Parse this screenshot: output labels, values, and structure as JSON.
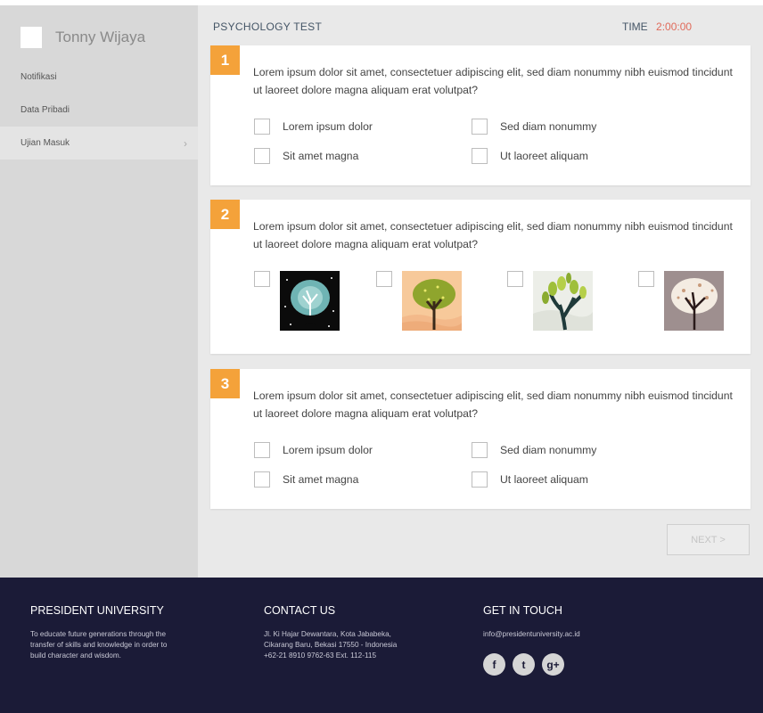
{
  "sidebar": {
    "user_name": "Tonny Wijaya",
    "items": [
      {
        "label": "Notifikasi"
      },
      {
        "label": "Data Pribadi"
      },
      {
        "label": "Ujian Masuk",
        "chevron": "›"
      }
    ]
  },
  "header": {
    "title": "PSYCHOLOGY TEST",
    "time_label": "TIME",
    "time_value": "2:00:00"
  },
  "questions": [
    {
      "number": "1",
      "text": "Lorem ipsum dolor sit amet, consectetuer adipiscing elit, sed diam nonummy nibh euismod tincidunt ut laoreet dolore magna aliquam erat volutpat?",
      "options": [
        "Lorem ipsum dolor",
        "Sed diam nonummy",
        "Sit amet magna",
        "Ut laoreet aliquam"
      ]
    },
    {
      "number": "2",
      "text": "Lorem ipsum dolor sit amet, consectetuer adipiscing elit, sed diam nonummy nibh euismod tincidunt ut laoreet dolore magna aliquam erat volutpat?",
      "image_options": [
        "tree-night-icon",
        "tree-sunset-icon",
        "tree-green-icon",
        "tree-blossom-icon"
      ]
    },
    {
      "number": "3",
      "text": "Lorem ipsum dolor sit amet, consectetuer adipiscing elit, sed diam nonummy nibh euismod tincidunt ut laoreet dolore magna aliquam erat volutpat?",
      "options": [
        "Lorem ipsum dolor",
        "Sed diam nonummy",
        "Sit amet magna",
        "Ut laoreet aliquam"
      ]
    }
  ],
  "next_label": "NEXT >",
  "footer": {
    "about": {
      "heading": "PRESIDENT UNIVERSITY",
      "lines": [
        "To educate future generations through the",
        "transfer of skills and knowledge in order to",
        "build character and wisdom."
      ]
    },
    "contact": {
      "heading": "CONTACT US",
      "lines": [
        "Jl. Ki Hajar Dewantara, Kota Jababeka,",
        "Cikarang Baru, Bekasi 17550 - Indonesia",
        "+62-21 8910 9762-63 Ext. 112-115"
      ]
    },
    "touch": {
      "heading": "GET IN TOUCH",
      "email": "info@presidentuniversity.ac.id",
      "social": [
        {
          "icon": "facebook-icon",
          "glyph": "f"
        },
        {
          "icon": "twitter-icon",
          "glyph": "t"
        },
        {
          "icon": "google-plus-icon",
          "glyph": "g+"
        }
      ]
    }
  },
  "colors": {
    "accent": "#f4a23a",
    "timer": "#e06a5a",
    "footer_bg": "#1b1b37"
  }
}
